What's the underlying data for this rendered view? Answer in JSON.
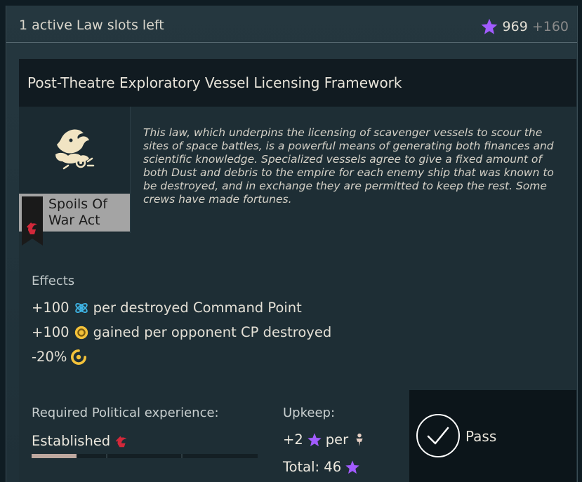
{
  "topbar": {
    "slots_text": "1 active Law slots left",
    "influence_value": "969",
    "influence_gain": "+160"
  },
  "law": {
    "title": "Post-Theatre Exploratory Vessel Licensing Framework",
    "name_line1": "Spoils Of",
    "name_line2": "War Act",
    "description": "This law, which underpins the licensing of scavenger vessels to scour the sites of space battles, is a powerful means of generating both finances and scientific knowledge. Specialized vessels agree to give a fixed amount of both Dust and debris to the empire for each enemy ship that was known to be destroyed, and in exchange they are permitted to keep the rest. Some crews have made fortunes."
  },
  "effects": {
    "label": "Effects",
    "items": [
      {
        "amount": "+100",
        "icon": "science-icon",
        "text": "per destroyed Command Point"
      },
      {
        "amount": "+100",
        "icon": "dust-icon",
        "text": "gained per opponent CP destroyed"
      },
      {
        "amount": "-20%",
        "icon": "dust-income-icon",
        "text": ""
      }
    ]
  },
  "requirement": {
    "label": "Required Political experience:",
    "value": "Established",
    "progress": 0.2
  },
  "upkeep": {
    "label": "Upkeep:",
    "per_amount": "+2",
    "per_text": "per",
    "total_text": "Total: 46"
  },
  "pass": {
    "label": "Pass"
  },
  "colors": {
    "influence": "#a15bff",
    "dust": "#f3c23a",
    "science": "#3fb5e6",
    "militarist": "#d2283a"
  }
}
